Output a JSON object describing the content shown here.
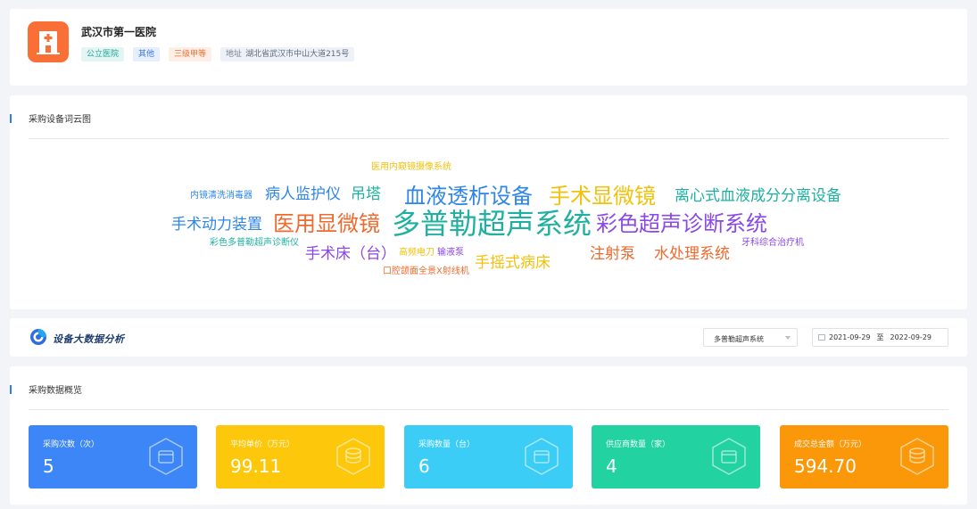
{
  "hospital": {
    "name": "武汉市第一医院",
    "tags": [
      "公立医院",
      "其他",
      "三级甲等"
    ],
    "address_label": "地址",
    "address": "湖北省武汉市中山大道215号"
  },
  "wordcloud": {
    "title": "采购设备词云图",
    "words": [
      {
        "text": "医用内窥镜摄像系统",
        "color": "#f2c10c"
      },
      {
        "text": "内镜清洗消毒器",
        "color": "#2f86e8"
      },
      {
        "text": "病人监护仪",
        "color": "#2f86e8"
      },
      {
        "text": "吊塔",
        "color": "#1fb0a0"
      },
      {
        "text": "血液透析设备",
        "color": "#2f86e8"
      },
      {
        "text": "手术显微镜",
        "color": "#f2c10c"
      },
      {
        "text": "离心式血液成分分离设备",
        "color": "#1fb0a0"
      },
      {
        "text": "手术动力装置",
        "color": "#2f86e8"
      },
      {
        "text": "医用显微镜",
        "color": "#ef6a2e"
      },
      {
        "text": "多普勒超声系统",
        "color": "#1fb0a0"
      },
      {
        "text": "彩色超声诊断系统",
        "color": "#8a48e6"
      },
      {
        "text": "彩色多普勒超声诊断仪",
        "color": "#1fb0a0"
      },
      {
        "text": "牙科综合治疗机",
        "color": "#8a48e6"
      },
      {
        "text": "手术床（台）",
        "color": "#8a48e6"
      },
      {
        "text": "高频电刀",
        "color": "#f2c10c"
      },
      {
        "text": "输液泵",
        "color": "#8a48e6"
      },
      {
        "text": "注射泵",
        "color": "#ef6a2e"
      },
      {
        "text": "水处理系统",
        "color": "#ef6a2e"
      },
      {
        "text": "手摇式病床",
        "color": "#f2c10c"
      },
      {
        "text": "口腔颌面全景X射线机",
        "color": "#ef6a2e"
      }
    ]
  },
  "bigdata": {
    "title": "设备大数据分析",
    "device_select": "多普勒超声系统",
    "date_start": "2021-09-29",
    "date_sep": "至",
    "date_end": "2022-09-29"
  },
  "overview": {
    "title": "采购数据概览",
    "stats": [
      {
        "label": "采购次数（次）",
        "value": "5",
        "color": "#3d86f7",
        "icon": "wallet-icon"
      },
      {
        "label": "平均单价（万元）",
        "value": "99.11",
        "color": "#fdc70b",
        "icon": "coins-icon"
      },
      {
        "label": "采购数量（台）",
        "value": "6",
        "color": "#3bcdf5",
        "icon": "wallet-icon"
      },
      {
        "label": "供应商数量（家）",
        "value": "4",
        "color": "#22d2a0",
        "icon": "wallet-icon"
      },
      {
        "label": "成交总金额（万元）",
        "value": "594.70",
        "color": "#fb9809",
        "icon": "coins-icon"
      }
    ]
  }
}
